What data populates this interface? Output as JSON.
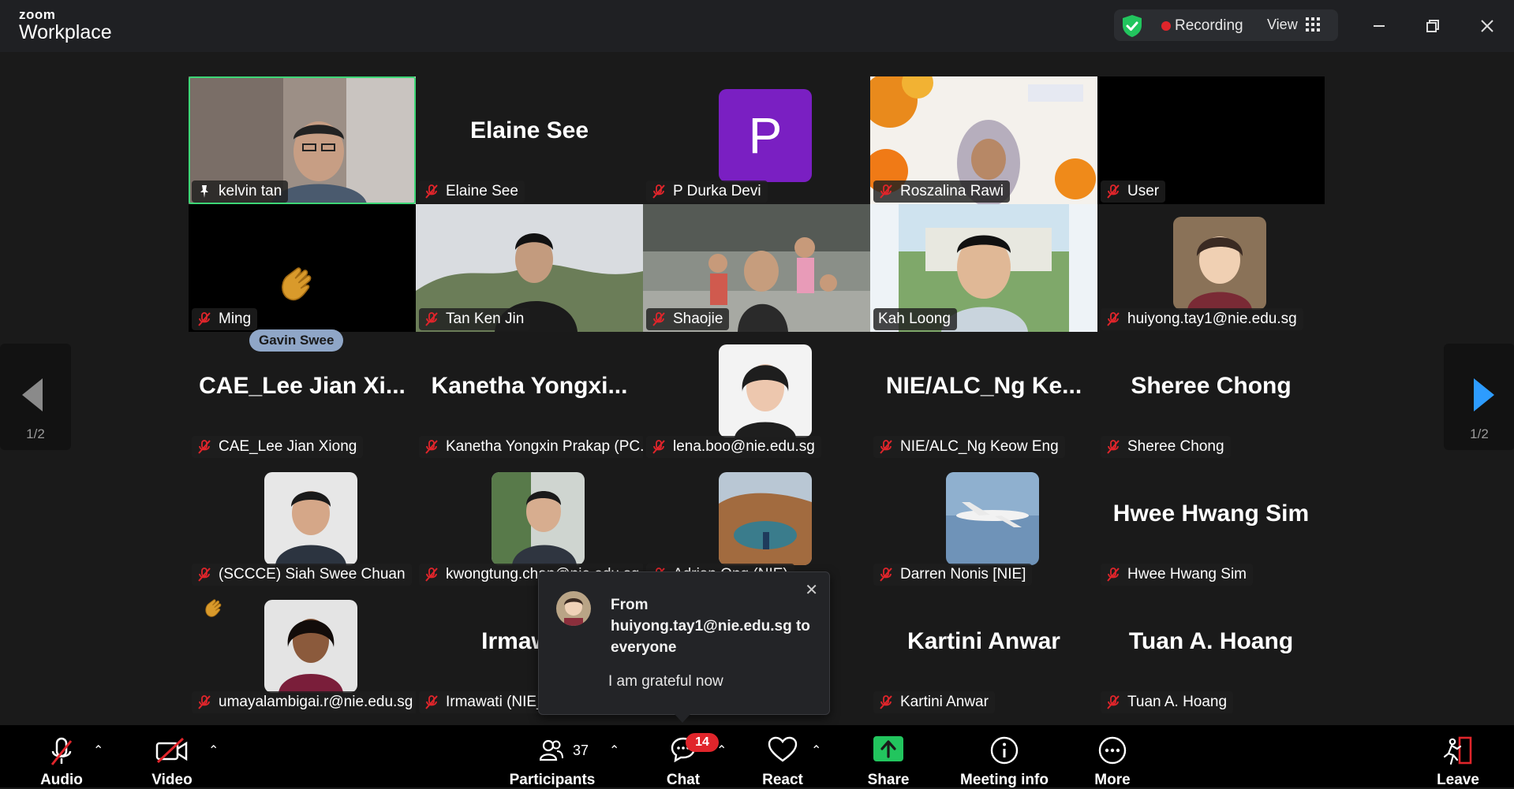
{
  "app": {
    "brand_small": "zoom",
    "brand_large": "Workplace"
  },
  "titlebar": {
    "recording_label": "Recording",
    "view_label": "View",
    "shield_color": "#22c55e"
  },
  "tiles": [
    {
      "name": "kelvin tan",
      "kind": "video",
      "pinned": true,
      "active": true
    },
    {
      "name": "Elaine See",
      "kind": "name",
      "center": "Elaine See"
    },
    {
      "name": "P Durka Devi",
      "kind": "letter",
      "letter": "P",
      "avatar_color": "#7a1fc2"
    },
    {
      "name": "Roszalina Rawi",
      "kind": "video"
    },
    {
      "name": "User",
      "kind": "blank"
    },
    {
      "name": "Ming",
      "kind": "blank",
      "reaction": "clap"
    },
    {
      "name": "Tan Ken Jin",
      "kind": "video"
    },
    {
      "name": "Shaojie",
      "kind": "video"
    },
    {
      "name": "Kah Loong",
      "kind": "video",
      "unmuted": true
    },
    {
      "name": "huiyong.tay1@nie.edu.sg",
      "kind": "photo"
    },
    {
      "name": "CAE_Lee Jian Xiong",
      "kind": "name",
      "center": "CAE_Lee  Jian  Xi..."
    },
    {
      "name": "Kanetha Yongxin Prakap (PC...",
      "kind": "name",
      "center": "Kanetha  Yongxi..."
    },
    {
      "name": "lena.boo@nie.edu.sg",
      "kind": "photo"
    },
    {
      "name": "NIE/ALC_Ng Keow Eng",
      "kind": "name",
      "center": "NIE/ALC_Ng  Ke..."
    },
    {
      "name": "Sheree Chong",
      "kind": "name",
      "center": "Sheree Chong"
    },
    {
      "name": "(SCCCE) Siah Swee Chuan",
      "kind": "photo"
    },
    {
      "name": "kwongtung.chan@nie.edu.sg",
      "kind": "photo"
    },
    {
      "name": "Adrian Ong (NIE)",
      "kind": "photo"
    },
    {
      "name": "Darren Nonis [NIE]",
      "kind": "photo"
    },
    {
      "name": "Hwee Hwang Sim",
      "kind": "name",
      "center": "Hwee Hwang Sim"
    },
    {
      "name": "umayalambigai.r@nie.edu.sg",
      "kind": "photo",
      "reaction": "clap"
    },
    {
      "name": "Irmawati (NIE_",
      "kind": "name",
      "center": "Irmawati"
    },
    {
      "name": "",
      "kind": "hidden"
    },
    {
      "name": "Kartini Anwar",
      "kind": "name",
      "center": "Kartini Anwar"
    },
    {
      "name": "Tuan A. Hoang",
      "kind": "name",
      "center": "Tuan A. Hoang"
    }
  ],
  "speaking_badge": "Gavin Swee",
  "pager": {
    "left_label": "1/2",
    "right_label": "1/2"
  },
  "chat_popup": {
    "from_text": "From huiyong.tay1@nie.edu.sg to everyone",
    "message": "I am grateful now"
  },
  "toolbar": {
    "audio": "Audio",
    "video": "Video",
    "participants": "Participants",
    "participant_count": "37",
    "chat": "Chat",
    "chat_badge": "14",
    "react": "React",
    "share": "Share",
    "meeting_info": "Meeting info",
    "more": "More",
    "leave": "Leave",
    "share_color": "#22c55e",
    "leave_color": "#e0252b"
  }
}
